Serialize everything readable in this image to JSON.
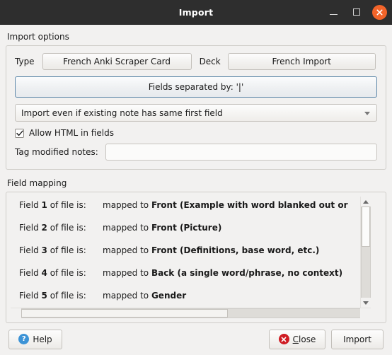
{
  "window": {
    "title": "Import",
    "minimize_icon": "minimize-icon",
    "maximize_icon": "maximize-icon",
    "close_icon": "close-icon",
    "close_color": "#f2642a",
    "titlebar_color": "#2e2e2e"
  },
  "import_options": {
    "group_label": "Import options",
    "type_label": "Type",
    "type_value": "French Anki Scraper Card",
    "deck_label": "Deck",
    "deck_value": "French Import",
    "separator_button": "Fields separated by: '|'",
    "separator_focus_color": "#5c86a8",
    "duplicate_policy": "Import even if existing note has same first field",
    "allow_html_label": "Allow HTML in fields",
    "allow_html_checked": true,
    "tag_label": "Tag modified notes:",
    "tag_value": "",
    "tag_placeholder": ""
  },
  "field_mapping": {
    "group_label": "Field mapping",
    "rows": [
      {
        "left": "Field 1 of file is:",
        "number": "1",
        "prefix": "mapped to ",
        "target": "Front (Example with word blanked out or"
      },
      {
        "left": "Field 2 of file is:",
        "number": "2",
        "prefix": "mapped to ",
        "target": "Front (Picture)"
      },
      {
        "left": "Field 3 of file is:",
        "number": "3",
        "prefix": "mapped to ",
        "target": "Front (Definitions, base word, etc.)"
      },
      {
        "left": "Field 4 of file is:",
        "number": "4",
        "prefix": "mapped to ",
        "target": "Back (a single word/phrase, no context)"
      },
      {
        "left": "Field 5 of file is:",
        "number": "5",
        "prefix": "mapped to ",
        "target": "Gender"
      }
    ],
    "row_left_parts": {
      "a": "Field ",
      "b": " of file is:"
    },
    "vertical_scrollbar": {
      "thumb_position_pct": 0,
      "thumb_size_pct": 44
    },
    "horizontal_scrollbar": {
      "thumb_position_pct": 0,
      "thumb_size_pct": 61
    }
  },
  "footer": {
    "help_label": "Help",
    "help_icon": "question-mark-icon",
    "help_icon_color": "#3c93d6",
    "close_label_mnemonic": "C",
    "close_label_rest": "lose",
    "close_icon": "close-circle-icon",
    "close_icon_color": "#cf1c23",
    "import_label": "Import"
  }
}
